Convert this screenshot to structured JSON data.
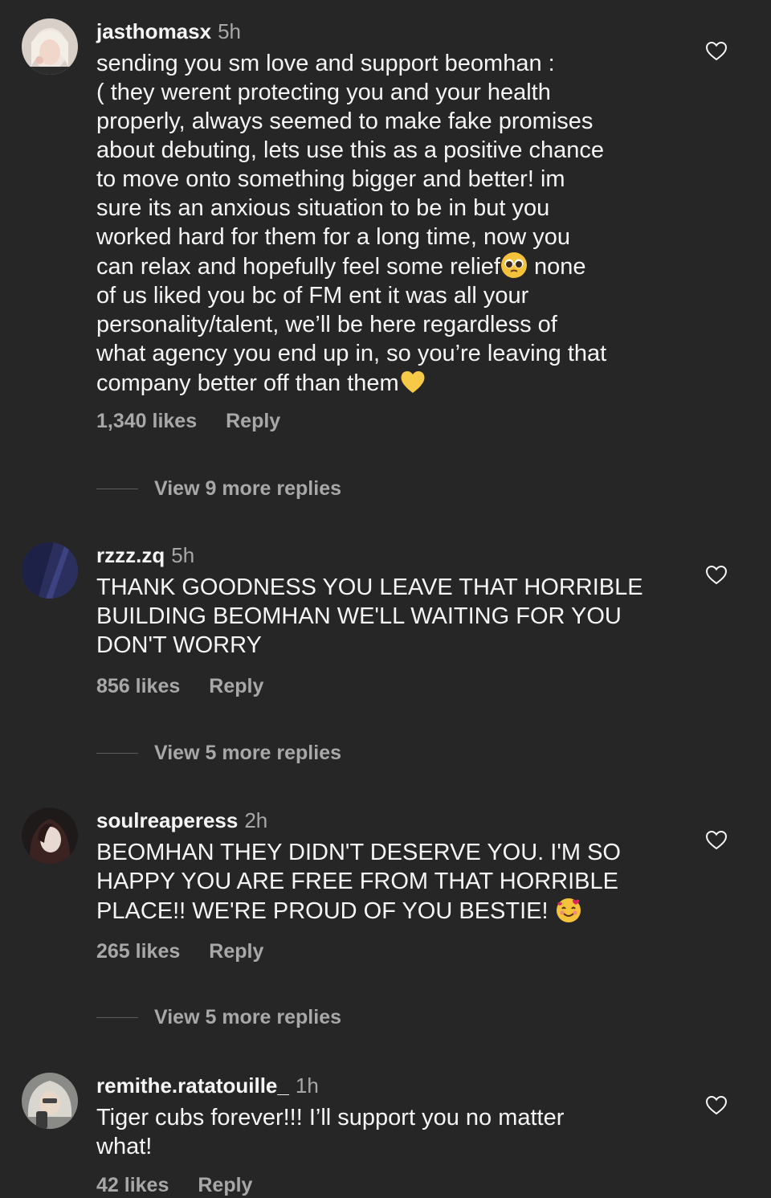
{
  "comments": [
    {
      "username": "jasthomasx",
      "time": "5h",
      "text_lines": [
        "sending you sm love and support beomhan :",
        "( they werent protecting you and your health",
        "properly, always seemed to make fake promises",
        "about debuting, lets use this as a positive chance",
        "to move onto something bigger and better! im",
        "sure its an anxious situation to be in but you",
        "worked hard for them for a long time, now you",
        "can relax and hopefully feel some relief",
        " none",
        "of us liked you bc of FM ent it was all your",
        "personality/talent, we’ll be here regardless of",
        "what agency you end up in, so you’re leaving that",
        "company better off than them"
      ],
      "likes": "1,340 likes",
      "reply": "Reply",
      "view_more": "View 9 more replies",
      "emojis": [
        "pleading-face-emoji",
        "yellow-heart-emoji"
      ]
    },
    {
      "username": "rzzz.zq",
      "time": "5h",
      "text_lines": [
        "THANK GOODNESS YOU LEAVE THAT HORRIBLE",
        "BUILDING BEOMHAN WE'LL WAITING FOR YOU",
        "DON'T WORRY"
      ],
      "likes": "856 likes",
      "reply": "Reply",
      "view_more": "View 5 more replies"
    },
    {
      "username": "soulreaperess",
      "time": "2h",
      "text_lines": [
        "BEOMHAN THEY DIDN'T DESERVE YOU. I'M SO",
        "HAPPY YOU ARE FREE FROM THAT HORRIBLE",
        "PLACE!! WE'RE PROUD OF YOU BESTIE!"
      ],
      "likes": "265 likes",
      "reply": "Reply",
      "view_more": "View 5 more replies",
      "emojis": [
        "smiling-face-with-hearts-emoji"
      ]
    },
    {
      "username": "remithe.ratatouille_",
      "time": "1h",
      "text_lines": [
        "Tiger cubs forever!!! I’ll support you no matter",
        "what!"
      ],
      "likes": "42 likes",
      "reply": "Reply"
    }
  ],
  "icons": {
    "like": "heart-outline-icon"
  },
  "colors": {
    "background": "#262626",
    "primary_text": "#f5f5f5",
    "secondary_text": "#a8a8a8"
  }
}
